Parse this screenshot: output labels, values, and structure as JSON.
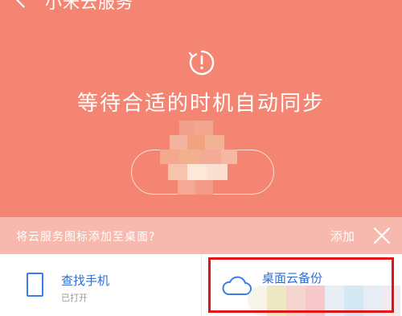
{
  "header": {
    "back_label": "<",
    "title": "小米云服务"
  },
  "status": {
    "icon": "sync-clock-icon",
    "message": "等待合适的时机自动同步"
  },
  "banner": {
    "text": "将云服务图标添加至桌面?",
    "add_label": "添加",
    "close_icon": "close-icon"
  },
  "tiles": [
    {
      "icon": "phone-icon",
      "title": "查找手机",
      "subtitle": "已打开"
    },
    {
      "icon": "cloud-icon",
      "title": "桌面云备份",
      "subtitle": ""
    }
  ],
  "colors": {
    "hero_bg": "#f48572",
    "banner_bg": "#f7b9ae",
    "accent_blue": "#2d6ed4",
    "highlight_red": "#e21416"
  }
}
